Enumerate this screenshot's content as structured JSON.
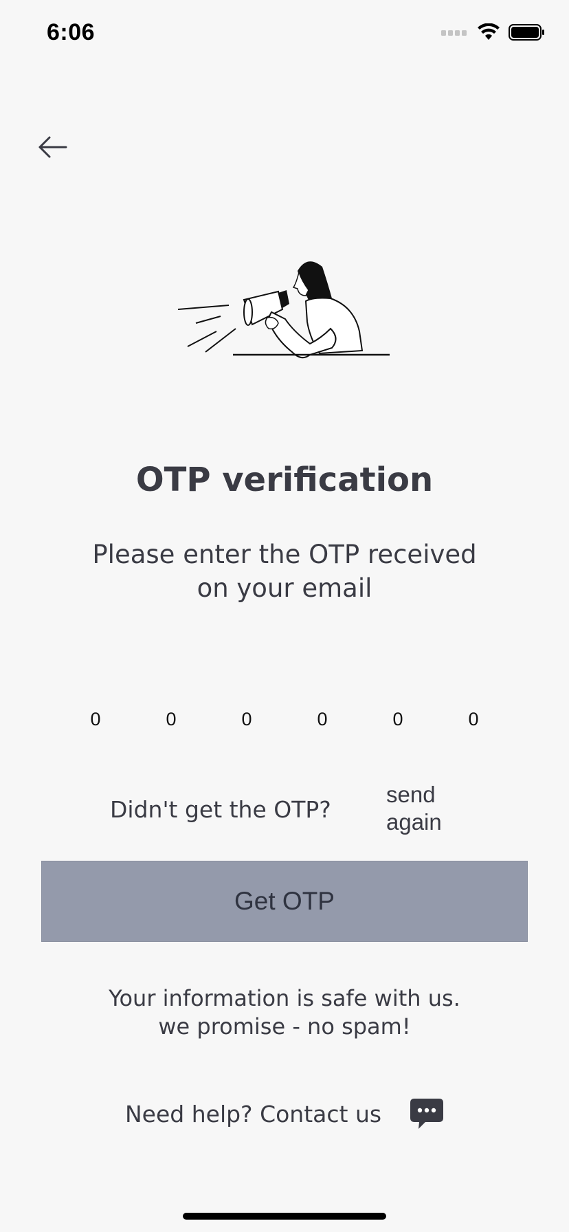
{
  "status_bar": {
    "time": "6:06"
  },
  "icons": {
    "signal": "cellular-signal-icon",
    "wifi": "wifi-icon",
    "battery": "battery-icon",
    "back": "arrow-left-icon",
    "chat": "chat-bubble-icon"
  },
  "main": {
    "title": "OTP verification",
    "subtitle": "Please enter the OTP received on your email"
  },
  "otp": {
    "digits": [
      "0",
      "0",
      "0",
      "0",
      "0",
      "0"
    ]
  },
  "resend": {
    "label": "Didn't get the OTP?",
    "link": "send again"
  },
  "button": {
    "get_otp": "Get OTP"
  },
  "footer": {
    "safe_line1": "Your information is safe with us.",
    "safe_line2": "we promise - no spam!",
    "help": "Need help? Contact us"
  },
  "colors": {
    "background": "#f7f7f7",
    "text": "#3a3b44",
    "button": "#949aab"
  }
}
